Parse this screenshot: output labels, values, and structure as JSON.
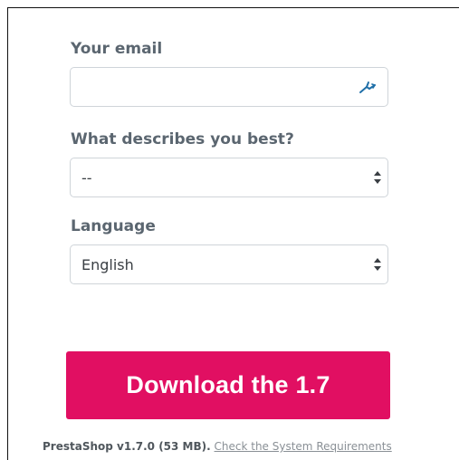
{
  "form": {
    "email_label": "Your email",
    "email_value": "",
    "role_label": "What describes you best?",
    "role_selected": "--",
    "language_label": "Language",
    "language_selected": "English"
  },
  "download": {
    "button_label": "Download the 1.7"
  },
  "footer": {
    "version_text": "PrestaShop v1.7.0 (53 MB).",
    "requirements_link": "Check the System Requirements"
  },
  "icons": {
    "email_field_icon": "autofill-key-icon",
    "select_arrows": "sort-arrows-icon"
  },
  "colors": {
    "accent": "#e10f62",
    "label": "#5b6670",
    "border": "#cfd4d9"
  }
}
